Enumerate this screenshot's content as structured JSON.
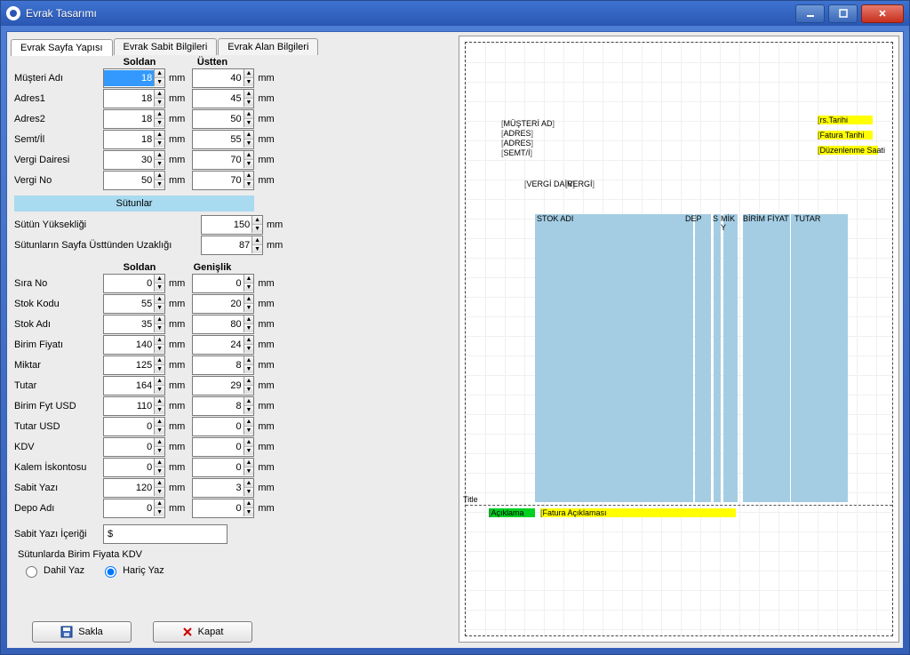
{
  "window": {
    "title": "Evrak Tasarımı"
  },
  "tabs": {
    "t1": "Evrak Sayfa Yapısı",
    "t2": "Evrak Sabit Bilgileri",
    "t3": "Evrak Alan Bilgileri"
  },
  "headers": {
    "soldan": "Soldan",
    "ustten": "Üstten",
    "genislik": "Genişlik"
  },
  "unit": "mm",
  "topFields": {
    "musteri": {
      "label": "Müşteri Adı",
      "soldan": "18",
      "ustten": "40"
    },
    "adres1": {
      "label": "Adres1",
      "soldan": "18",
      "ustten": "45"
    },
    "adres2": {
      "label": "Adres2",
      "soldan": "18",
      "ustten": "50"
    },
    "semtil": {
      "label": "Semt/İl",
      "soldan": "18",
      "ustten": "55"
    },
    "vdaire": {
      "label": "Vergi Dairesi",
      "soldan": "30",
      "ustten": "70"
    },
    "vno": {
      "label": "Vergi No",
      "soldan": "50",
      "ustten": "70"
    }
  },
  "sutunlarHeader": "Sütunlar",
  "sutun": {
    "yuk": {
      "label": "Sütün Yüksekliği",
      "value": "150"
    },
    "uzak": {
      "label": "Sütunların Sayfa Üsttünden Uzaklığı",
      "value": "87"
    }
  },
  "cols": {
    "sirano": {
      "label": "Sıra No",
      "soldan": "0",
      "genislik": "0"
    },
    "stokkodu": {
      "label": "Stok Kodu",
      "soldan": "55",
      "genislik": "20"
    },
    "stokadi": {
      "label": "Stok Adı",
      "soldan": "35",
      "genislik": "80"
    },
    "bfiyat": {
      "label": "Birim Fiyatı",
      "soldan": "140",
      "genislik": "24"
    },
    "miktar": {
      "label": "Miktar",
      "soldan": "125",
      "genislik": "8"
    },
    "tutar": {
      "label": "Tutar",
      "soldan": "164",
      "genislik": "29"
    },
    "bfusd": {
      "label": "Birim Fyt USD",
      "soldan": "110",
      "genislik": "8"
    },
    "tutusd": {
      "label": "Tutar USD",
      "soldan": "0",
      "genislik": "0"
    },
    "kdv": {
      "label": "KDV",
      "soldan": "0",
      "genislik": "0"
    },
    "isk": {
      "label": "Kalem İskontosu",
      "soldan": "0",
      "genislik": "0"
    },
    "sabit": {
      "label": "Sabit Yazı",
      "soldan": "120",
      "genislik": "3"
    },
    "depo": {
      "label": "Depo Adı",
      "soldan": "0",
      "genislik": "0"
    }
  },
  "sabitYazi": {
    "label": "Sabit Yazı İçeriği",
    "value": "$"
  },
  "kdvGroup": {
    "label": "Sütunlarda Birim Fiyata KDV",
    "dahil": "Dahil Yaz",
    "haric": "Hariç Yaz"
  },
  "buttons": {
    "sakla": "Sakla",
    "kapat": "Kapat"
  },
  "preview": {
    "musteri": "MÜŞTERİ AD",
    "adres1": "ADRES",
    "adres2": "ADRES",
    "semtil": "SEMT/İ",
    "vdaire": "VERGİ DAİR",
    "vno": "VERGİ",
    "rstarih": "rs.Tarihi",
    "ftarih": "Fatura Tarihi",
    "dsaat": "Düzenlenme Saati",
    "stokadi": "STOK ADI",
    "depo": "DEP",
    "s": "S",
    "mik": "MİK\nY",
    "bfiyat": "BİRİM FİYAT",
    "tutar": "TUTAR",
    "title": "Title",
    "aciklama": "Açıklama",
    "faturaack": "Fatura Açıklaması"
  }
}
